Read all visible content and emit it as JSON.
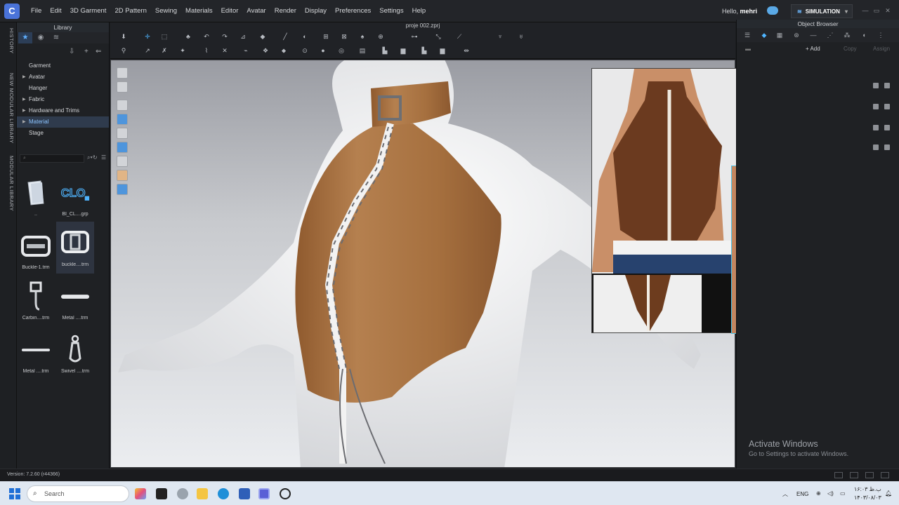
{
  "menu": {
    "items": [
      "File",
      "Edit",
      "3D Garment",
      "2D Pattern",
      "Sewing",
      "Materials",
      "Editor",
      "Avatar",
      "Render",
      "Display",
      "Preferences",
      "Settings",
      "Help"
    ],
    "hello_prefix": "Hello,",
    "user": "mehri",
    "simulation_label": "SIMULATION"
  },
  "vertical_tabs": [
    "HISTORY",
    "NEW MODULAR LIBRARY",
    "MODULAR LIBRARY"
  ],
  "library": {
    "title": "Library",
    "tree": [
      {
        "label": "Garment",
        "has_arrow": false
      },
      {
        "label": "Avatar",
        "has_arrow": true
      },
      {
        "label": "Hanger",
        "has_arrow": false
      },
      {
        "label": "Fabric",
        "has_arrow": true
      },
      {
        "label": "Hardware and Trims",
        "has_arrow": true
      },
      {
        "label": "Material",
        "has_arrow": true
      },
      {
        "label": "Stage",
        "has_arrow": false
      }
    ],
    "selected_tree_index": 5,
    "thumbnails": [
      {
        "caption": "..",
        "icon": "folder-icon"
      },
      {
        "caption": "BI_CL....grp",
        "icon": "clo-logo-icon"
      },
      {
        "caption": "Buckle-1.trm",
        "icon": "buckle-icon"
      },
      {
        "caption": "buckle....trm",
        "icon": "buckle-icon"
      },
      {
        "caption": "Carbin....trm",
        "icon": "carabiner-icon"
      },
      {
        "caption": "Metal ....trm",
        "icon": "metal-bar-icon"
      },
      {
        "caption": "Metal ....trm",
        "icon": "metal-bar-icon"
      },
      {
        "caption": "Swivel ....trm",
        "icon": "swivel-hook-icon"
      }
    ],
    "selected_thumbnail_index": 3
  },
  "toolbar": {
    "file_name": "proje 002.zprj"
  },
  "object_browser": {
    "title": "Object Browser",
    "add_label": "+ Add",
    "copy_label": "Copy",
    "assign_label": "Assign"
  },
  "watermark": {
    "line1": "Activate Windows",
    "line2": "Go to Settings to activate Windows."
  },
  "status": {
    "version": "Version: 7.2.60 (r44366)"
  },
  "taskbar": {
    "search_placeholder": "Search",
    "language": "ENG",
    "time": "۱۶:۰۳ ب.ظ",
    "date": "۱۴۰۳/۰۸/۰۳"
  },
  "colors": {
    "accent": "#4fb5ff",
    "garment_leather": "#a9713f",
    "reference_leather": "#6b3a1f"
  }
}
